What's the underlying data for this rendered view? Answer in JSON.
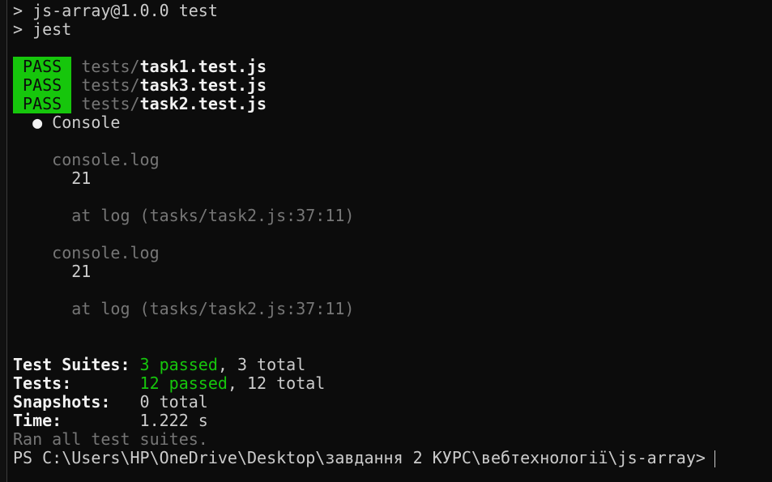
{
  "output": {
    "cmd1": "> js-array@1.0.0 test",
    "cmd2": "> jest",
    "results": [
      {
        "badge": "PASS",
        "dir": "tests/",
        "file": "task1.test.js"
      },
      {
        "badge": "PASS",
        "dir": "tests/",
        "file": "task3.test.js"
      },
      {
        "badge": "PASS",
        "dir": "tests/",
        "file": "task2.test.js"
      }
    ],
    "console_header": "Console",
    "logs": [
      {
        "label": "console.log",
        "value": "21",
        "at": "at log (tasks/task2.js:37:11)"
      },
      {
        "label": "console.log",
        "value": "21",
        "at": "at log (tasks/task2.js:37:11)"
      }
    ],
    "summary": {
      "suites_label": "Test Suites: ",
      "suites_passed": "3 passed",
      "suites_total": ", 3 total",
      "tests_label": "Tests:       ",
      "tests_passed": "12 passed",
      "tests_total": ", 12 total",
      "snapshots_label": "Snapshots:   ",
      "snapshots_value": "0 total",
      "time_label": "Time:        ",
      "time_value": "1.222 s",
      "ran": "Ran all test suites."
    },
    "prompt": "PS C:\\Users\\HP\\OneDrive\\Desktop\\завдання 2 КУРС\\вебтехнології\\js-array>"
  },
  "colors": {
    "background": "#0c0c0c",
    "green": "#16c60c",
    "dim": "#767676"
  }
}
